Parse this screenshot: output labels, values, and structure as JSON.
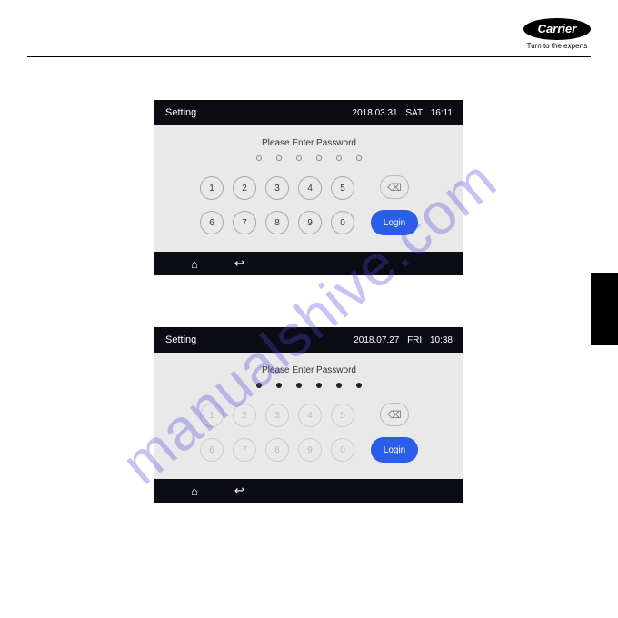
{
  "brand": {
    "name": "Carrier",
    "tagline": "Turn to the experts"
  },
  "watermark": "manualshive.com",
  "panels": [
    {
      "title": "Setting",
      "date": "2018.03.31",
      "day": "SAT",
      "time": "16:11",
      "prompt": "Please Enter Password",
      "filled": false,
      "row1": [
        "1",
        "2",
        "3",
        "4",
        "5"
      ],
      "row2": [
        "6",
        "7",
        "8",
        "9",
        "0"
      ],
      "delete_glyph": "⌫",
      "login": "Login"
    },
    {
      "title": "Setting",
      "date": "2018.07.27",
      "day": "FRI",
      "time": "10:38",
      "prompt": "Please Enter Password",
      "filled": true,
      "row1": [
        "1",
        "2",
        "3",
        "4",
        "5"
      ],
      "row2": [
        "6",
        "7",
        "8",
        "9",
        "0"
      ],
      "delete_glyph": "⌫",
      "login": "Login"
    }
  ],
  "icons": {
    "home": "⌂",
    "back": "↩"
  }
}
